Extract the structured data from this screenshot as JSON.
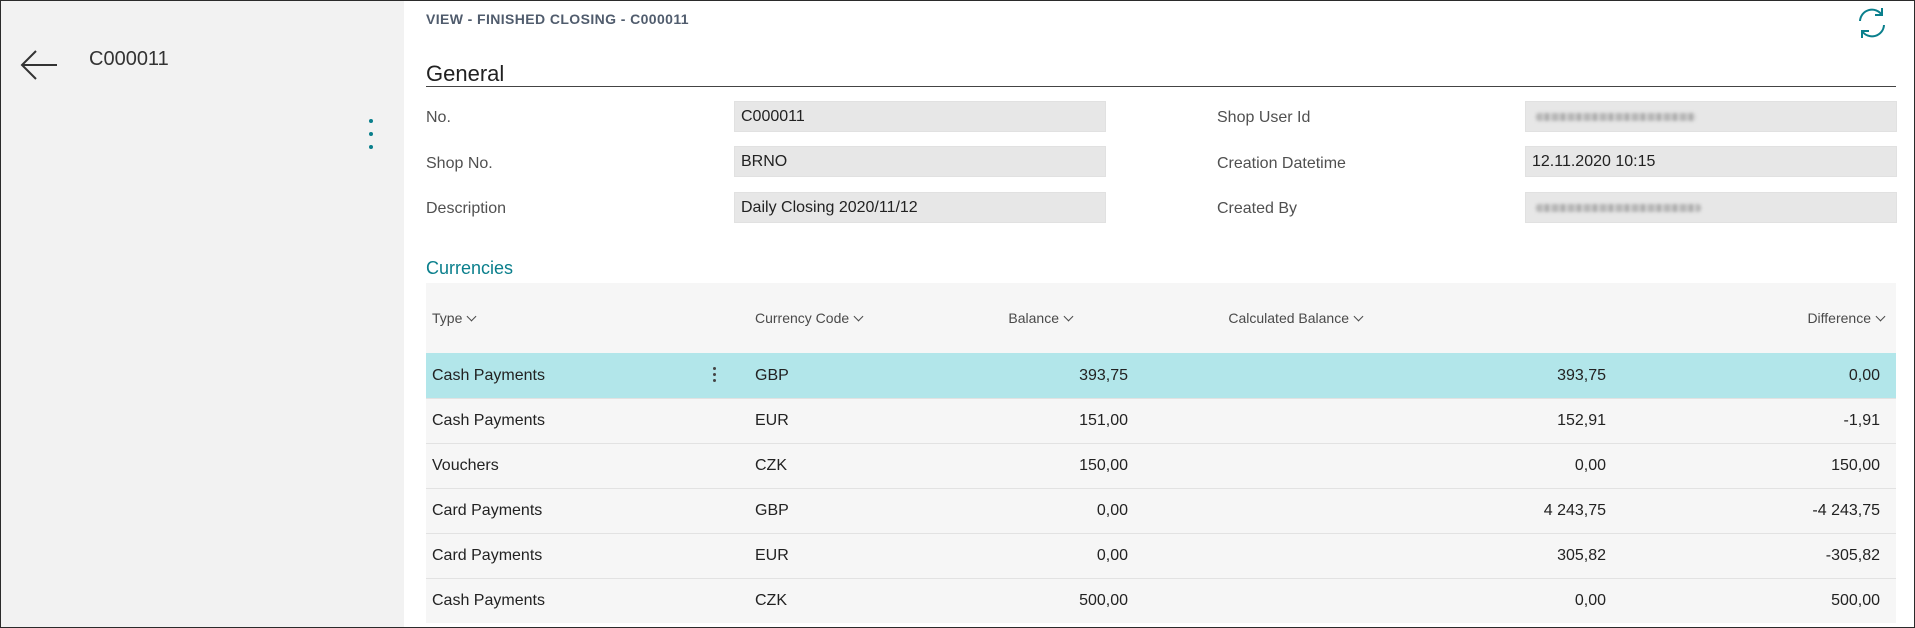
{
  "nav": {
    "record_id": "C000011"
  },
  "header": {
    "caption": "VIEW - FINISHED CLOSING - C000011"
  },
  "general": {
    "title": "General",
    "fields": [
      {
        "label": "No.",
        "value": "C000011",
        "redacted": false
      },
      {
        "label": "Shop No.",
        "value": "BRNO",
        "redacted": false
      },
      {
        "label": "Description",
        "value": "Daily Closing 2020/11/12",
        "redacted": false
      },
      {
        "label": "Shop User Id",
        "value": "",
        "redacted": true
      },
      {
        "label": "Creation Datetime",
        "value": "12.11.2020 10:15",
        "redacted": false
      },
      {
        "label": "Created By",
        "value": "",
        "redacted": true
      }
    ]
  },
  "currencies": {
    "title": "Currencies",
    "columns": [
      "Type",
      "Currency Code",
      "Balance",
      "Calculated Balance",
      "Difference"
    ],
    "rows": [
      {
        "type": "Cash Payments",
        "currency": "GBP",
        "balance": "393,75",
        "calculated": "393,75",
        "difference": "0,00",
        "selected": true
      },
      {
        "type": "Cash Payments",
        "currency": "EUR",
        "balance": "151,00",
        "calculated": "152,91",
        "difference": "-1,91",
        "selected": false
      },
      {
        "type": "Vouchers",
        "currency": "CZK",
        "balance": "150,00",
        "calculated": "0,00",
        "difference": "150,00",
        "selected": false
      },
      {
        "type": "Card Payments",
        "currency": "GBP",
        "balance": "0,00",
        "calculated": "4 243,75",
        "difference": "-4 243,75",
        "selected": false
      },
      {
        "type": "Card Payments",
        "currency": "EUR",
        "balance": "0,00",
        "calculated": "305,82",
        "difference": "-305,82",
        "selected": false
      },
      {
        "type": "Cash Payments",
        "currency": "CZK",
        "balance": "500,00",
        "calculated": "0,00",
        "difference": "500,00",
        "selected": false
      }
    ]
  },
  "theme": {
    "accent": "#0a7f8c",
    "selected_row": "#b2e6ea",
    "pane_bg": "#f2f2f2",
    "field_bg": "#e7e7e7"
  },
  "icons": {
    "back": "arrow-left-icon",
    "refresh": "refresh-icon",
    "more": "more-vertical-icon",
    "sort": "chevron-down-icon"
  }
}
